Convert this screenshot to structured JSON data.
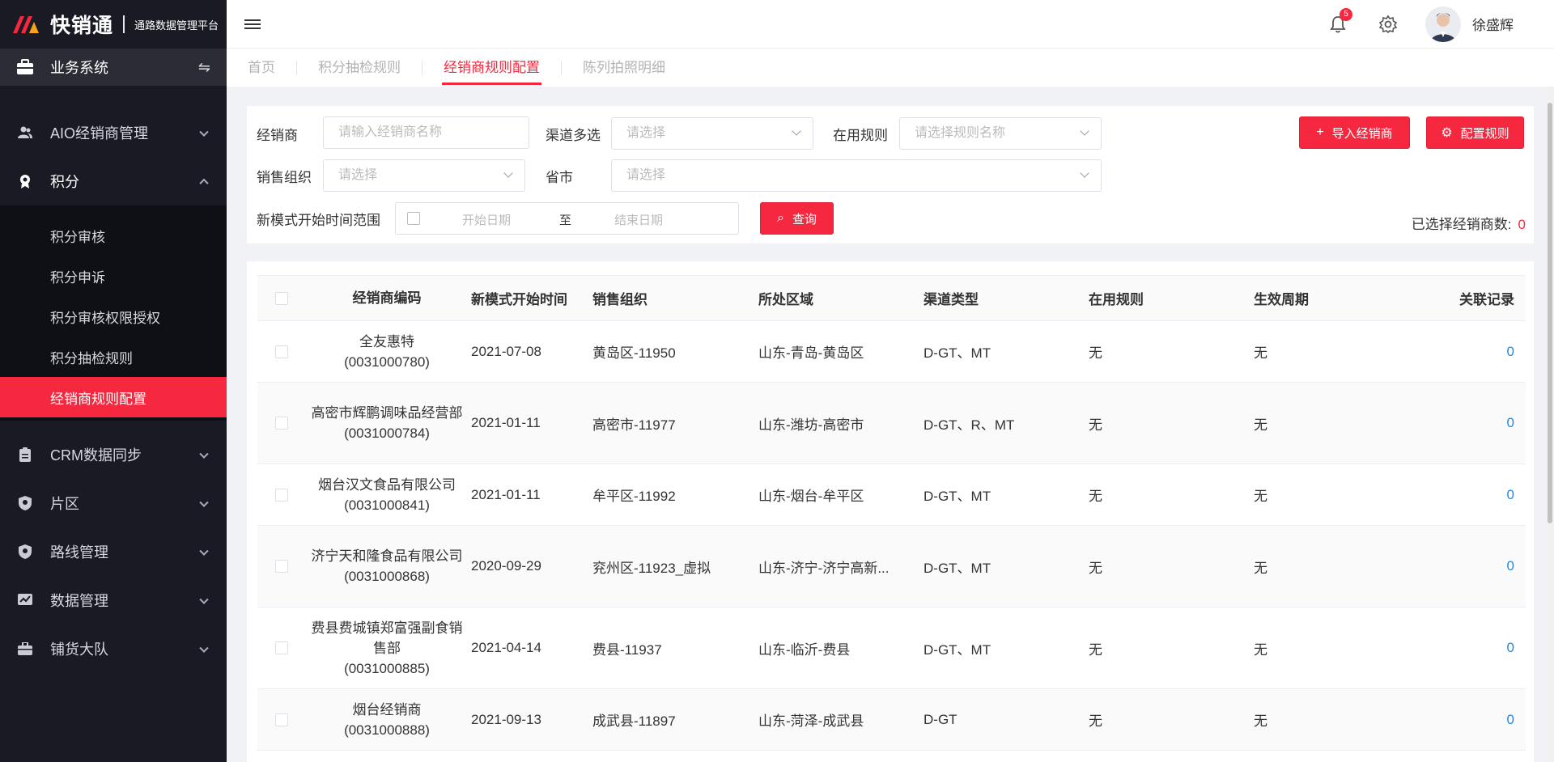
{
  "brand": {
    "name": "快销通",
    "subtitle": "通路数据管理平台"
  },
  "sidebar": {
    "system_label": "业务系统",
    "menu": [
      {
        "label": "AIO经销商管理",
        "icon": "user-group-icon"
      },
      {
        "label": "积分",
        "icon": "medal-icon",
        "expanded": true,
        "children": [
          "积分审核",
          "积分申诉",
          "积分审核权限授权",
          "积分抽检规则",
          "经销商规则配置"
        ]
      },
      {
        "label": "CRM数据同步",
        "icon": "clipboard-icon"
      },
      {
        "label": "片区",
        "icon": "shield-icon"
      },
      {
        "label": "路线管理",
        "icon": "shield-icon"
      },
      {
        "label": "数据管理",
        "icon": "chart-icon"
      },
      {
        "label": "铺货大队",
        "icon": "briefcase-icon"
      }
    ],
    "active_child": "经销商规则配置"
  },
  "header": {
    "notification_count": "5",
    "user_name": "徐盛辉"
  },
  "tabs": [
    "首页",
    "积分抽检规则",
    "经销商规则配置",
    "陈列拍照明细"
  ],
  "active_tab": "经销商规则配置",
  "filters": {
    "dealer_label": "经销商",
    "dealer_placeholder": "请输入经销商名称",
    "channel_label": "渠道多选",
    "channel_placeholder": "请选择",
    "rule_label": "在用规则",
    "rule_placeholder": "请选择规则名称",
    "org_label": "销售组织",
    "org_placeholder": "请选择",
    "province_label": "省市",
    "province_placeholder": "请选择",
    "date_label": "新模式开始时间范围",
    "date_start": "开始日期",
    "date_to": "至",
    "date_end": "结束日期",
    "query_btn": "查询",
    "import_btn": "导入经销商",
    "config_btn": "配置规则",
    "selected_label": "已选择经销商数:",
    "selected_count": "0"
  },
  "table": {
    "headers": [
      "经销商编码",
      "新模式开始时间",
      "销售组织",
      "所处区域",
      "渠道类型",
      "在用规则",
      "生效周期",
      "关联记录"
    ],
    "rows": [
      {
        "name": "全友惠特",
        "code": "(0031000780)",
        "date": "2021-07-08",
        "org": "黄岛区-11950",
        "area": "山东-青岛-黄岛区",
        "channel": "D-GT、MT",
        "rule": "无",
        "cycle": "无",
        "records": "0"
      },
      {
        "name": "高密市辉鹏调味品经营部",
        "code": "(0031000784)",
        "date": "2021-01-11",
        "org": "高密市-11977",
        "area": "山东-潍坊-高密市",
        "channel": "D-GT、R、MT",
        "rule": "无",
        "cycle": "无",
        "records": "0"
      },
      {
        "name": "烟台汉文食品有限公司",
        "code": "(0031000841)",
        "date": "2021-01-11",
        "org": "牟平区-11992",
        "area": "山东-烟台-牟平区",
        "channel": "D-GT、MT",
        "rule": "无",
        "cycle": "无",
        "records": "0"
      },
      {
        "name": "济宁天和隆食品有限公司",
        "code": "(0031000868)",
        "date": "2020-09-29",
        "org": "兖州区-11923_虚拟",
        "area": "山东-济宁-济宁高新...",
        "channel": "D-GT、MT",
        "rule": "无",
        "cycle": "无",
        "records": "0"
      },
      {
        "name": "费县费城镇郑富强副食销售部",
        "code": "(0031000885)",
        "date": "2021-04-14",
        "org": "费县-11937",
        "area": "山东-临沂-费县",
        "channel": "D-GT、MT",
        "rule": "无",
        "cycle": "无",
        "records": "0"
      },
      {
        "name": "烟台经销商",
        "code": "(0031000888)",
        "date": "2021-09-13",
        "org": "成武县-11897",
        "area": "山东-菏泽-成武县",
        "channel": "D-GT",
        "rule": "无",
        "cycle": "无",
        "records": "0"
      }
    ]
  }
}
